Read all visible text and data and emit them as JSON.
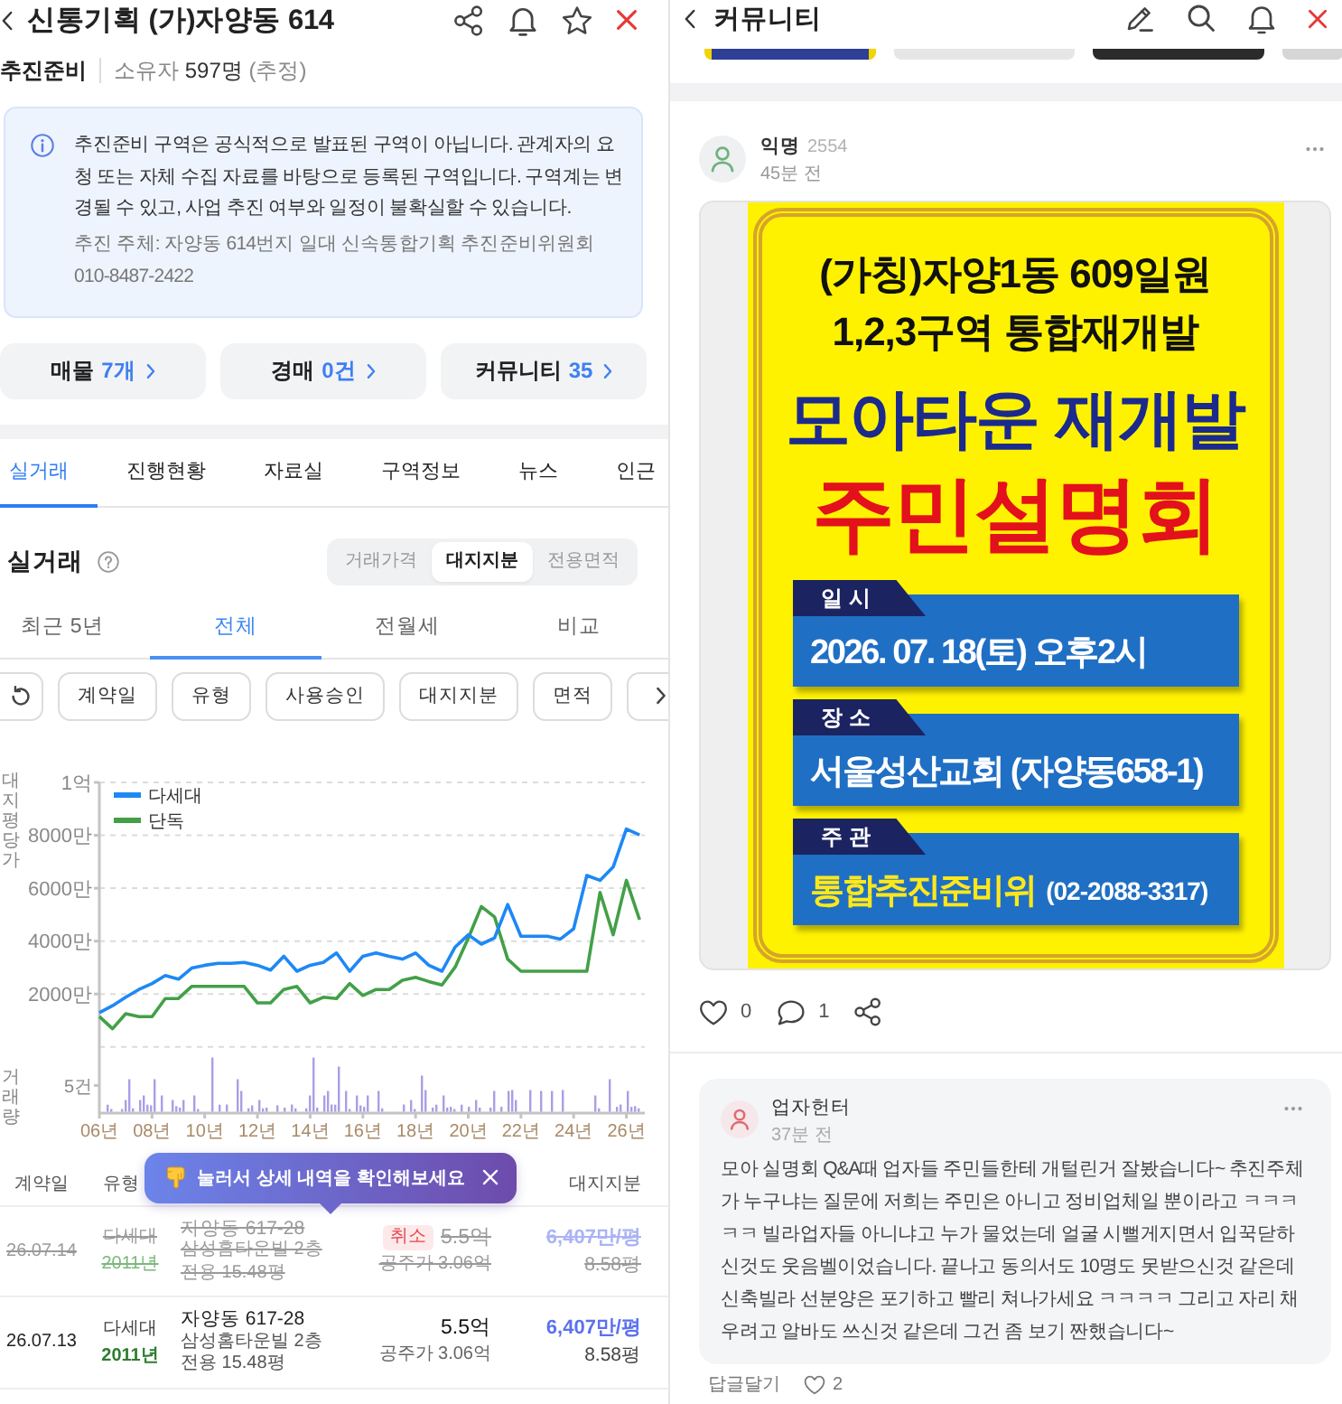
{
  "left_panel": {
    "header": {
      "title": "신통기획 (가)자양동 614"
    },
    "summary": {
      "stage": "추진준비",
      "owners": "소유자 **597명** (추정)"
    },
    "notice": {
      "text": "추진준비 구역은 공식적으로 발표된 구역이 아닙니다. 관계자의 요청 또는 자체 수집 자료를 바탕으로 등록된 구역입니다. 구역계는 변경될 수 있고, 사업 추진 여부와 일정이 불확실할 수 있습니다.",
      "organizer": "추진 주체: 자양동 614번지 일대 신속통합기획 추진준비위원회 010-8487-2422"
    },
    "quick_links": [
      {
        "label": "매물",
        "count": "7개"
      },
      {
        "label": "경매",
        "count": "0건"
      },
      {
        "label": "커뮤니티",
        "count": "35"
      }
    ],
    "tabs": [
      {
        "label": "실거래",
        "selected": true
      },
      {
        "label": "진행현황",
        "selected": false
      },
      {
        "label": "자료실",
        "selected": false
      },
      {
        "label": "구역정보",
        "selected": false
      },
      {
        "label": "뉴스",
        "selected": false
      },
      {
        "label": "인근",
        "selected": false
      }
    ],
    "section": {
      "title": "실거래",
      "value_modes": [
        {
          "label": "거래가격",
          "selected": false
        },
        {
          "label": "대지지분",
          "selected": true
        },
        {
          "label": "전용면적",
          "selected": false
        }
      ],
      "periods": [
        {
          "label": "최근 5년",
          "selected": false
        },
        {
          "label": "전체",
          "selected": true
        },
        {
          "label": "전월세",
          "selected": false
        },
        {
          "label": "비교",
          "selected": false
        }
      ],
      "filters": [
        "계약일",
        "유형",
        "사용승인",
        "대지지분",
        "면적"
      ]
    },
    "chart": {
      "chart_data": {
        "type": "line",
        "ylabel": "대지평당가",
        "x": [
          6,
          6.5,
          7,
          7.5,
          8,
          8.5,
          9,
          9.5,
          10,
          10.5,
          11,
          11.5,
          12,
          12.5,
          13,
          13.5,
          14,
          14.5,
          15,
          15.5,
          16,
          16.5,
          17,
          17.5,
          18,
          18.5,
          19,
          19.5,
          20,
          20.5,
          21,
          21.5,
          22,
          22.5,
          23,
          23.5,
          24,
          24.5,
          25,
          25.5,
          26,
          26.5
        ],
        "series": [
          {
            "name": "다세대",
            "color": "#1e88f5",
            "values": [
              1300,
              1560,
              1880,
              2170,
              2400,
              2700,
              2560,
              2980,
              3090,
              3160,
              3160,
              3200,
              3090,
              2900,
              3430,
              2860,
              3090,
              3200,
              3550,
              2860,
              3430,
              3550,
              3430,
              3320,
              3550,
              3090,
              2860,
              3780,
              4240,
              3890,
              4120,
              5380,
              4190,
              4190,
              4190,
              4080,
              4470,
              6480,
              6300,
              6800,
              8240,
              8010
            ]
          },
          {
            "name": "단독",
            "color": "#43a047",
            "values": [
              1150,
              690,
              1260,
              1150,
              1150,
              1830,
              1830,
              2290,
              2290,
              2290,
              2290,
              2290,
              1670,
              1670,
              2170,
              2290,
              1670,
              1880,
              1830,
              2400,
              1950,
              2170,
              2170,
              2520,
              2630,
              2470,
              2340,
              3020,
              4120,
              5310,
              4920,
              3320,
              2860,
              2860,
              2860,
              2860,
              2860,
              2860,
              5840,
              4240,
              6300,
              4810
            ]
          }
        ],
        "xlim": [
          6,
          26.7
        ],
        "ylim": [
          -2500,
          10000
        ],
        "xticks": [
          {
            "value": 6,
            "label": "06년"
          },
          {
            "value": 8,
            "label": "08년"
          },
          {
            "value": 10,
            "label": "10년"
          },
          {
            "value": 12,
            "label": "12년"
          },
          {
            "value": 14,
            "label": "14년"
          },
          {
            "value": 16,
            "label": "16년"
          },
          {
            "value": 18,
            "label": "18년"
          },
          {
            "value": 20,
            "label": "20년"
          },
          {
            "value": 22,
            "label": "22년"
          },
          {
            "value": 24,
            "label": "24년"
          },
          {
            "value": 26,
            "label": "26년"
          }
        ],
        "yticks": [
          {
            "value": 2000,
            "label": "2000만"
          },
          {
            "value": 4000,
            "label": "4000만"
          },
          {
            "value": 6000,
            "label": "6000만"
          },
          {
            "value": 8000,
            "label": "8000만"
          }
        ],
        "grid": true,
        "legend": true
      },
      "top_tick": "1억",
      "volume_label": "거래량",
      "volume_tick": "5건"
    },
    "tooltip": {
      "text": "눌러서 상세 내역을 확인해보세요"
    },
    "table": {
      "columns": {
        "contract_date": "계약일",
        "type": "유형",
        "land_share": "대지지분"
      },
      "rows": [
        {
          "date": "26.07.14",
          "type": "다세대",
          "built": "2011년",
          "address": "자양동 617-28",
          "building": "삼성홈타운빌 2층",
          "area": "전용 15.48평",
          "cancelled": true,
          "badge": "취소",
          "price": "5.5억",
          "assessed": "공주가 3.06억",
          "unit_price": "6,407만/평",
          "land_share": "8.58평"
        },
        {
          "date": "26.07.13",
          "type": "다세대",
          "built": "2011년",
          "address": "자양동 617-28",
          "building": "삼성홈타운빌 2층",
          "area": "전용 15.48평",
          "cancelled": false,
          "price": "5.5억",
          "assessed": "공주가 3.06억",
          "unit_price": "6,407만/평",
          "land_share": "8.58평"
        }
      ]
    }
  },
  "right_panel": {
    "header": {
      "title": "커뮤니티"
    },
    "post": {
      "author": "익명",
      "author_number": "2554",
      "time": "45분 전",
      "poster": {
        "headline": [
          "(가칭)자양1동 609일원",
          "1,2,3구역 통합재개발"
        ],
        "title": "모아타운 재개발",
        "subtitle": "주민설명회",
        "details": [
          {
            "label": "일 시",
            "value": "2026. 07. 18(토) 오후2시",
            "highlight": false
          },
          {
            "label": "장 소",
            "value": "서울성산교회 (자양동658-1)",
            "highlight": false
          },
          {
            "label": "주 관",
            "value": "통합추진준비위",
            "note": "(02-2088-3317)",
            "highlight": true
          }
        ]
      },
      "likes": "0",
      "comments": "1"
    },
    "comment": {
      "author": "업자헌터",
      "time": "37분 전",
      "text": "모아 실명회 Q&A때 업자들 주민들한테 개털린거 잘봤습니다~ 추진주체가 누구냐는 질문에 저희는 주민은 아니고 정비업체일 뿐이라고 ㅋㅋㅋㅋㅋ 빌라업자들 아니냐고 누가 물었는데 얼굴 시뻘게지면서 입꾹닫하신것도 웃음벨이었습니다. 끝나고 동의서도 10명도 못받으신것 같은데 신축빌라 선분양은 포기하고 빨리 쳐나가세요 ㅋㅋㅋㅋ 그리고 자리 채우려고 알바도 쓰신것 같은데 그건 좀 보기 짠했습니다~",
      "reply": "답글달기",
      "likes": "2"
    }
  }
}
